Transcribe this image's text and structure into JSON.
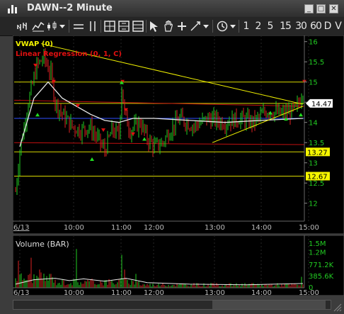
{
  "window": {
    "title": "DAWN--2 Minute",
    "buttons": [
      "_",
      "□",
      "✕"
    ]
  },
  "toolbar": {
    "icons": [
      "bar-chart-icon",
      "line-chart-icon",
      "candle-chart-icon",
      "dropdown-icon",
      "hline-icon",
      "vline-icon",
      "crosshair-grid-icon",
      "grid-icon",
      "layout-icon",
      "pointer-icon",
      "hand-icon",
      "crosshair-icon",
      "trendline-icon",
      "clock-icon"
    ],
    "intervals": [
      "1",
      "2",
      "5",
      "15",
      "30",
      "60",
      "D",
      "V"
    ]
  },
  "price_panel": {
    "indicators": [
      {
        "label": "VWAP (0)",
        "color": "#f0f000"
      },
      {
        "label": "Linear Regression (0, 1, C)",
        "color": "#e01010"
      }
    ],
    "y_ticks": [
      "16",
      "15.5",
      "15",
      "14.5",
      "14",
      "13.5",
      "13",
      "12.5",
      "12"
    ],
    "x_ticks": [
      "6/13",
      "10:00",
      "11:00",
      "12:00",
      "13:00",
      "14:00",
      "15:00"
    ],
    "price_labels": [
      {
        "text": "14.47",
        "bg": "#ffffff",
        "fg": "#000000"
      },
      {
        "text": "13.27",
        "bg": "#f5f500",
        "fg": "#000000"
      },
      {
        "text": "12.67",
        "bg": "#f5f500",
        "fg": "#000000"
      }
    ]
  },
  "volume_panel": {
    "label": "Volume (BAR)",
    "y_ticks": [
      "1.5M",
      "1.2M",
      "771.2K",
      "385.6K",
      "0"
    ],
    "x_ticks": [
      "6/13",
      "10:00",
      "11:00",
      "12:00",
      "13:00",
      "14:00",
      "15:00"
    ]
  },
  "colors": {
    "up_bar": "#22cc22",
    "down_bar": "#dd2222",
    "vwap": "#f0f000",
    "regression": "#e01010",
    "hline": "#d8d800",
    "blue_line": "#3050ff",
    "red_hline": "#c01010"
  }
}
